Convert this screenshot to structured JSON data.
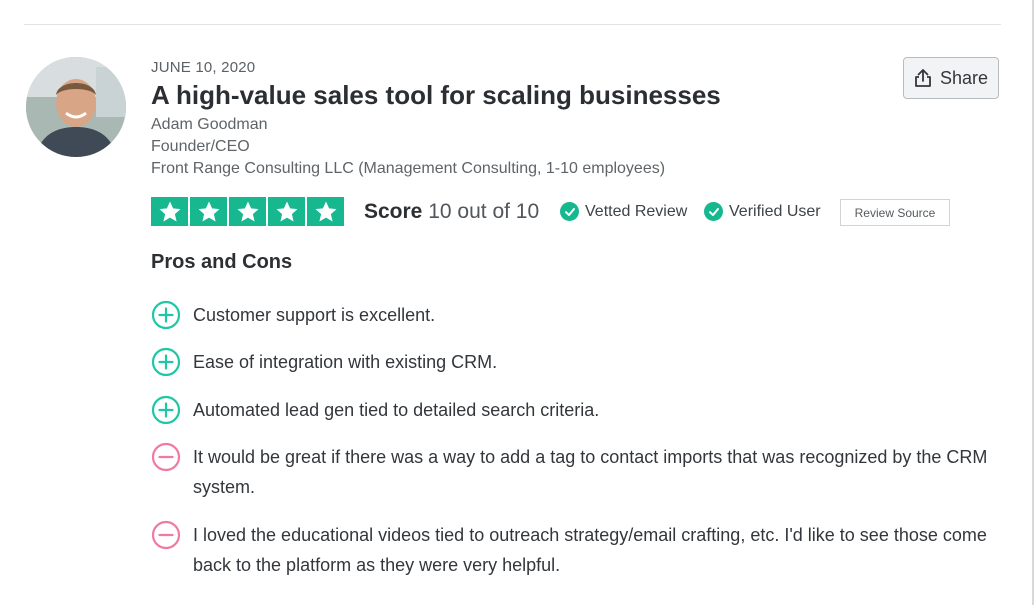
{
  "review": {
    "date": "JUNE 10, 2020",
    "title": "A high-value sales tool for scaling businesses",
    "reviewer": {
      "name": "Adam Goodman",
      "role": "Founder/CEO",
      "company": "Front Range Consulting LLC (Management Consulting, 1-10 employees)"
    },
    "rating": {
      "stars": 5,
      "max_stars": 5,
      "score_label": "Score",
      "score_value": "10 out of 10"
    },
    "badges": {
      "vetted": "Vetted Review",
      "verified": "Verified User"
    },
    "review_source_label": "Review Source",
    "share_label": "Share"
  },
  "pros_cons": {
    "heading": "Pros and Cons",
    "items": [
      {
        "type": "pro",
        "text": "Customer support is excellent."
      },
      {
        "type": "pro",
        "text": "Ease of integration with existing CRM."
      },
      {
        "type": "pro",
        "text": "Automated lead gen tied to detailed search criteria."
      },
      {
        "type": "con",
        "text": "It would be great if there was a way to add a tag to contact imports that was recognized by the CRM system."
      },
      {
        "type": "con",
        "text": "I loved the educational videos tied to outreach strategy/email crafting, etc. I'd like to see those come back to the platform as they were very helpful."
      }
    ]
  },
  "colors": {
    "accent_green": "#17b890",
    "pro_icon": "#1fc7a5",
    "con_icon": "#ef7aa6"
  },
  "icons": {
    "share": "share-icon",
    "star": "star-icon",
    "check": "check-circle-icon",
    "pro": "plus-circle-icon",
    "con": "minus-circle-icon"
  }
}
